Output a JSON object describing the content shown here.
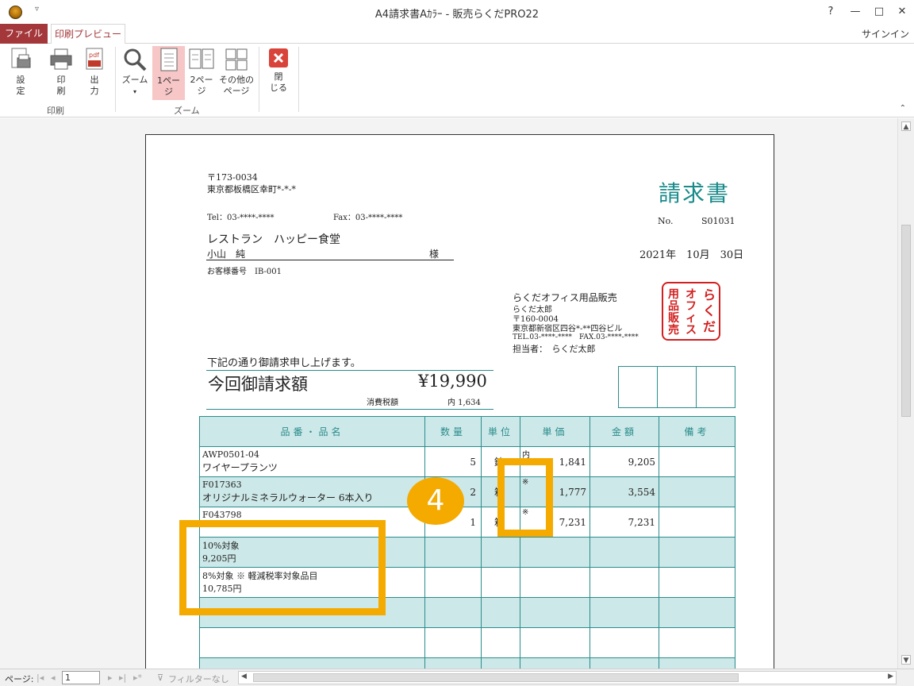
{
  "window": {
    "title": "A4請求書Aｶﾗｰ - 販売らくだPRO22",
    "help": "?",
    "minimize": "—",
    "maximize": "□",
    "close": "✕",
    "qat": "▿"
  },
  "tabs": {
    "file": "ファイル",
    "print_preview": "印刷プレビュー",
    "signin": "サインイン"
  },
  "ribbon": {
    "settings": "設\n定",
    "print": "印\n刷",
    "output": "出\n力",
    "zoom": "ズーム",
    "one_page": "1ペー\nジ",
    "two_pages": "2ペー\nジ",
    "other_pages": "その他の\nページ",
    "close": "閉\nじる",
    "group_print": "印刷",
    "group_zoom": "ズーム"
  },
  "invoice": {
    "postal": "〒173-0034",
    "address": "東京都板橋区幸町*-*-*",
    "tel": "Tel：03-****-****",
    "fax": "Fax：03-****-****",
    "title": "請求書",
    "no_label": "No.",
    "no_value": "S01031",
    "customer_company": "レストラン　ハッピー食堂",
    "customer_person": "小山　純",
    "honorific": "様",
    "date": "2021年　10月　30日",
    "customer_id": "お客様番号　IB-001",
    "seller_name": "らくだオフィス用品販売",
    "seller_person": "らくだ太郎",
    "seller_postal": "〒160-0004",
    "seller_address": "東京都新宿区四谷*-**四谷ビル",
    "seller_tel": "TEL.03-****-****　FAX.03-****-****",
    "tantou": "担当者：　らくだ太郎",
    "seal_lines": [
      "らくだ",
      "オフィス",
      "用品販売"
    ],
    "intro": "下記の通り御請求申し上げます。",
    "amount_label": "今回御請求額",
    "amount_value": "¥19,990",
    "tax_label": "消費税額",
    "tax_value": "内 1,634"
  },
  "table": {
    "headers": [
      "品番・品名",
      "数量",
      "単位",
      "単価",
      "金額",
      "備考"
    ],
    "rows": [
      {
        "code": "AWP0501-04",
        "name": "ワイヤープランツ",
        "qty": "5",
        "unit": "鉢",
        "mark": "内",
        "price": "1,841",
        "amount": "9,205"
      },
      {
        "code": "F017363",
        "name": "オリジナルミネラルウォーター 6本入り",
        "qty": "2",
        "unit": "箱",
        "mark": "※",
        "price": "1,777",
        "amount": "3,554"
      },
      {
        "code": "F043798",
        "name": "",
        "qty": "1",
        "unit": "箱",
        "mark": "※",
        "price": "7,231",
        "amount": "7,231"
      }
    ],
    "summary_10_label": "10%対象",
    "summary_10_value": "9,205円",
    "summary_8_label": "8%対象 ※ 軽減税率対象品目",
    "summary_8_value": "10,785円"
  },
  "overlay": {
    "step_number": "4"
  },
  "statusbar": {
    "page_label": "ページ:",
    "page_value": "1",
    "filter": "フィルターなし"
  },
  "colors": {
    "accent_red": "#a4373a",
    "teal": "#1a8a8a",
    "highlight": "#f5aa00",
    "seal_red": "#d21f1f"
  }
}
